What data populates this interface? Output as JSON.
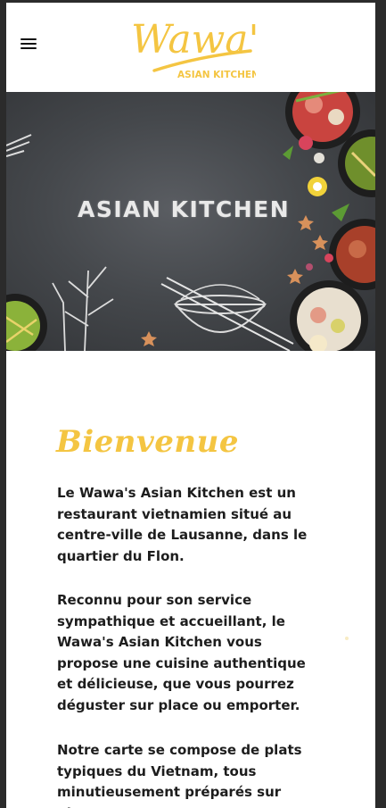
{
  "header": {
    "menu_icon": "hamburger-menu-icon",
    "logo": {
      "script_text": "Wawa's",
      "subtitle": "ASIAN KITCHEN",
      "color": "#f4c542"
    }
  },
  "hero": {
    "title": "ASIAN KITCHEN"
  },
  "content": {
    "heading": "Bienvenue",
    "paragraphs": [
      "Le Wawa's Asian Kitchen est un restaurant vietnamien situé au centre-ville de Lausanne, dans le quartier du Flon.",
      "Reconnu pour son service sympathique et accueillant, le Wawa's Asian Kitchen vous propose une cuisine authentique et délicieuse, que vous pourrez déguster sur place ou emporter.",
      "Notre carte se compose de plats typiques du Vietnam, tous minutieusement préparés sur place,"
    ],
    "accent_color": "#f4c542"
  }
}
